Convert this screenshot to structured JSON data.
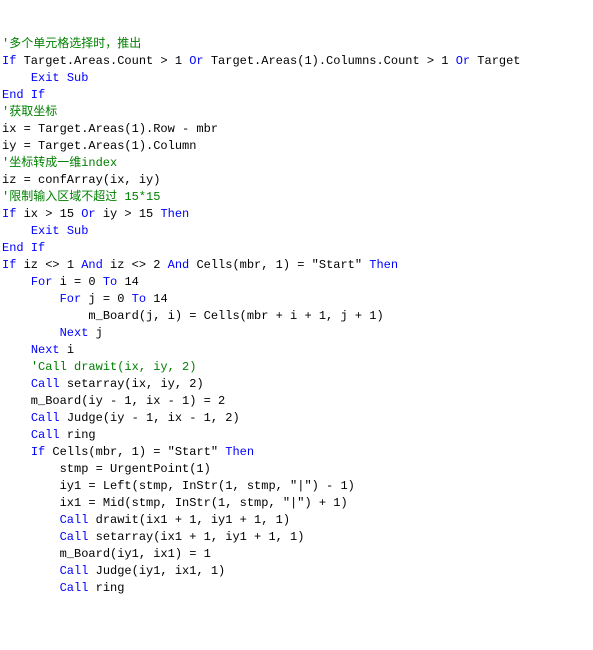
{
  "lines": [
    [
      [
        "c-comment",
        "'多个单元格选择时，推出"
      ]
    ],
    [
      [
        "c-keyword",
        "If"
      ],
      [
        "c-text",
        " Target.Areas.Count > 1 "
      ],
      [
        "c-keyword",
        "Or"
      ],
      [
        "c-text",
        " Target.Areas(1).Columns.Count > 1 "
      ],
      [
        "c-keyword",
        "Or"
      ],
      [
        "c-text",
        " Target"
      ]
    ],
    [
      [
        "c-text",
        "    "
      ],
      [
        "c-keyword",
        "Exit Sub"
      ]
    ],
    [
      [
        "c-keyword",
        "End If"
      ]
    ],
    [
      [
        "c-text",
        ""
      ]
    ],
    [
      [
        "c-comment",
        "'获取坐标"
      ]
    ],
    [
      [
        "c-text",
        "ix = Target.Areas(1).Row - mbr"
      ]
    ],
    [
      [
        "c-text",
        "iy = Target.Areas(1).Column"
      ]
    ],
    [
      [
        "c-comment",
        "'坐标转成一维index"
      ]
    ],
    [
      [
        "c-text",
        "iz = confArray(ix, iy)"
      ]
    ],
    [
      [
        "c-text",
        ""
      ]
    ],
    [
      [
        "c-comment",
        "'限制输入区域不超过 15*15"
      ]
    ],
    [
      [
        "c-keyword",
        "If"
      ],
      [
        "c-text",
        " ix > 15 "
      ],
      [
        "c-keyword",
        "Or"
      ],
      [
        "c-text",
        " iy > 15 "
      ],
      [
        "c-keyword",
        "Then"
      ]
    ],
    [
      [
        "c-text",
        "    "
      ],
      [
        "c-keyword",
        "Exit Sub"
      ]
    ],
    [
      [
        "c-keyword",
        "End If"
      ]
    ],
    [
      [
        "c-keyword",
        "If"
      ],
      [
        "c-text",
        " iz <> 1 "
      ],
      [
        "c-keyword",
        "And"
      ],
      [
        "c-text",
        " iz <> 2 "
      ],
      [
        "c-keyword",
        "And"
      ],
      [
        "c-text",
        " Cells(mbr, 1) = \"Start\" "
      ],
      [
        "c-keyword",
        "Then"
      ]
    ],
    [
      [
        "c-text",
        "    "
      ],
      [
        "c-keyword",
        "For"
      ],
      [
        "c-text",
        " i = 0 "
      ],
      [
        "c-keyword",
        "To"
      ],
      [
        "c-text",
        " 14"
      ]
    ],
    [
      [
        "c-text",
        "        "
      ],
      [
        "c-keyword",
        "For"
      ],
      [
        "c-text",
        " j = 0 "
      ],
      [
        "c-keyword",
        "To"
      ],
      [
        "c-text",
        " 14"
      ]
    ],
    [
      [
        "c-text",
        "            m_Board(j, i) = Cells(mbr + i + 1, j + 1)"
      ]
    ],
    [
      [
        "c-text",
        "        "
      ],
      [
        "c-keyword",
        "Next"
      ],
      [
        "c-text",
        " j"
      ]
    ],
    [
      [
        "c-text",
        "    "
      ],
      [
        "c-keyword",
        "Next"
      ],
      [
        "c-text",
        " i"
      ]
    ],
    [
      [
        "c-text",
        ""
      ]
    ],
    [
      [
        "c-text",
        "    "
      ],
      [
        "c-comment",
        "'Call drawit(ix, iy, 2)"
      ]
    ],
    [
      [
        "c-text",
        "    "
      ],
      [
        "c-keyword",
        "Call"
      ],
      [
        "c-text",
        " setarray(ix, iy, 2)"
      ]
    ],
    [
      [
        "c-text",
        "    m_Board(iy - 1, ix - 1) = 2"
      ]
    ],
    [
      [
        "c-text",
        "    "
      ],
      [
        "c-keyword",
        "Call"
      ],
      [
        "c-text",
        " Judge(iy - 1, ix - 1, 2)"
      ]
    ],
    [
      [
        "c-text",
        "    "
      ],
      [
        "c-keyword",
        "Call"
      ],
      [
        "c-text",
        " ring"
      ]
    ],
    [
      [
        "c-text",
        ""
      ]
    ],
    [
      [
        "c-text",
        "    "
      ],
      [
        "c-keyword",
        "If"
      ],
      [
        "c-text",
        " Cells(mbr, 1) = \"Start\" "
      ],
      [
        "c-keyword",
        "Then"
      ]
    ],
    [
      [
        "c-text",
        "        stmp = UrgentPoint(1)"
      ]
    ],
    [
      [
        "c-text",
        "        iy1 = Left(stmp, InStr(1, stmp, \"|\") - 1)"
      ]
    ],
    [
      [
        "c-text",
        "        ix1 = Mid(stmp, InStr(1, stmp, \"|\") + 1)"
      ]
    ],
    [
      [
        "c-text",
        "        "
      ],
      [
        "c-keyword",
        "Call"
      ],
      [
        "c-text",
        " drawit(ix1 + 1, iy1 + 1, 1)"
      ]
    ],
    [
      [
        "c-text",
        "        "
      ],
      [
        "c-keyword",
        "Call"
      ],
      [
        "c-text",
        " setarray(ix1 + 1, iy1 + 1, 1)"
      ]
    ],
    [
      [
        "c-text",
        "        m_Board(iy1, ix1) = 1"
      ]
    ],
    [
      [
        "c-text",
        "        "
      ],
      [
        "c-keyword",
        "Call"
      ],
      [
        "c-text",
        " Judge(iy1, ix1, 1)"
      ]
    ],
    [
      [
        "c-text",
        "        "
      ],
      [
        "c-keyword",
        "Call"
      ],
      [
        "c-text",
        " ring"
      ]
    ]
  ]
}
